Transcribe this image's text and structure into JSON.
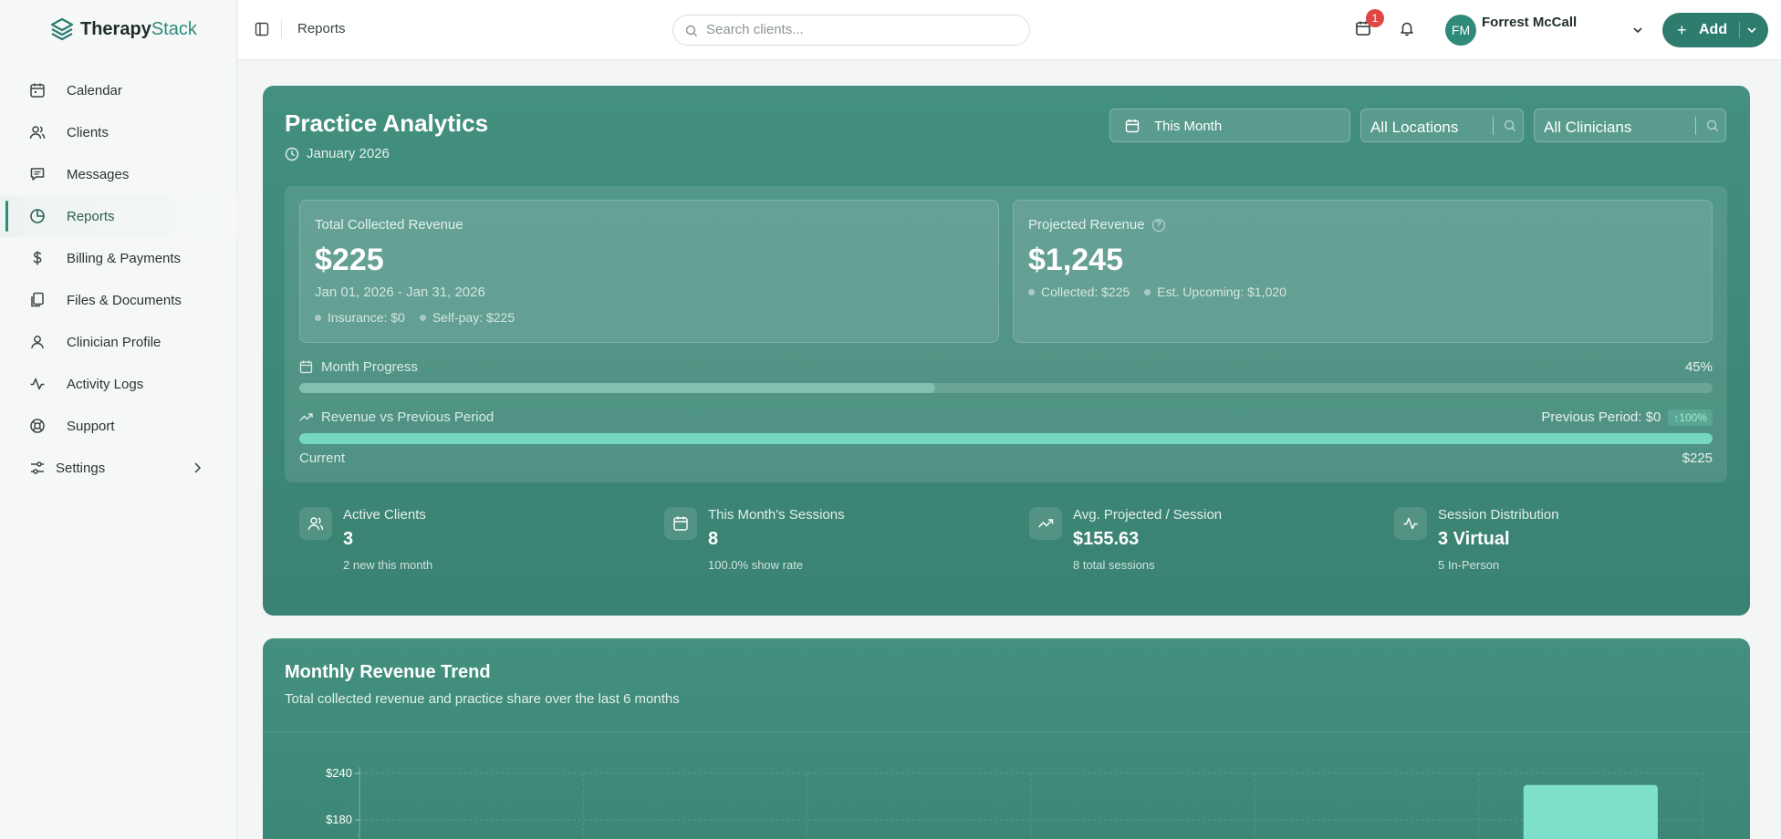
{
  "app": {
    "brand_bold": "Therapy",
    "brand_light": "Stack"
  },
  "sidebar": {
    "items": [
      {
        "label": "Calendar",
        "icon": "calendar-icon"
      },
      {
        "label": "Clients",
        "icon": "users-icon"
      },
      {
        "label": "Messages",
        "icon": "message-icon"
      },
      {
        "label": "Reports",
        "icon": "pie-chart-icon",
        "active": true
      },
      {
        "label": "Billing & Payments",
        "icon": "dollar-icon"
      },
      {
        "label": "Files & Documents",
        "icon": "files-icon"
      },
      {
        "label": "Clinician Profile",
        "icon": "user-icon"
      },
      {
        "label": "Activity Logs",
        "icon": "activity-icon"
      },
      {
        "label": "Support",
        "icon": "lifebuoy-icon"
      },
      {
        "label": "Settings",
        "icon": "sliders-icon"
      }
    ]
  },
  "topbar": {
    "breadcrumb": "Reports",
    "search_placeholder": "Search clients...",
    "notification_count": "1",
    "user_initials": "FM",
    "user_name": "Forrest McCall",
    "add_label": "Add"
  },
  "analytics": {
    "title": "Practice Analytics",
    "period": "January 2026",
    "filters": {
      "period": "This Month",
      "location": "All Locations",
      "clinician": "All Clinicians"
    },
    "collected": {
      "label": "Total Collected Revenue",
      "value": "$225",
      "range": "Jan 01, 2026 - Jan 31, 2026",
      "insurance": "Insurance: $0",
      "selfpay": "Self-pay: $225"
    },
    "projected": {
      "label": "Projected Revenue",
      "value": "$1,245",
      "collected": "Collected: $225",
      "upcoming": "Est. Upcoming: $1,020"
    },
    "month_progress": {
      "label": "Month Progress",
      "percent_text": "45%",
      "fraction": 0.45
    },
    "vs_previous": {
      "label": "Revenue vs Previous Period",
      "previous": "Previous Period: $0",
      "change": "↑100%",
      "current_label": "Current",
      "current_value": "$225",
      "fraction": 1.0
    },
    "metrics": [
      {
        "label": "Active Clients",
        "value": "3",
        "sub": "2 new this month",
        "icon": "users-icon"
      },
      {
        "label": "This Month's Sessions",
        "value": "8",
        "sub": "100.0% show rate",
        "icon": "calendar-icon"
      },
      {
        "label": "Avg. Projected / Session",
        "value": "$155.63",
        "sub": "8 total sessions",
        "icon": "trending-up-icon"
      },
      {
        "label": "Session Distribution",
        "value": "3 Virtual",
        "sub": "5 In-Person",
        "icon": "activity-icon"
      }
    ]
  },
  "trend": {
    "title": "Monthly Revenue Trend",
    "subtitle": "Total collected revenue and practice share over the last 6 months"
  },
  "chart_data": {
    "type": "bar",
    "title": "Monthly Revenue Trend",
    "yticks": [
      "$240",
      "$180"
    ],
    "ylim": [
      0,
      240
    ],
    "values": [
      0,
      0,
      0,
      0,
      0,
      225
    ],
    "grid": true,
    "bar_color": "#7fe0c9"
  }
}
